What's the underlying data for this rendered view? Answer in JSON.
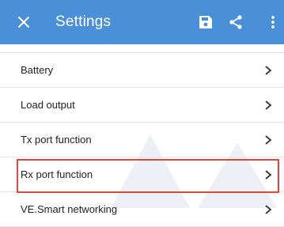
{
  "header": {
    "title": "Settings",
    "bar_color": "#4a90d9",
    "icons": [
      "close-icon",
      "save-icon",
      "share-icon",
      "more-vertical-icon"
    ]
  },
  "settings": {
    "items": [
      {
        "label": "Battery"
      },
      {
        "label": "Load output"
      },
      {
        "label": "Tx port function"
      },
      {
        "label": "Rx port function"
      },
      {
        "label": "VE.Smart networking"
      }
    ],
    "highlighted_item": "Rx port function",
    "highlight_color": "#e0473a"
  }
}
